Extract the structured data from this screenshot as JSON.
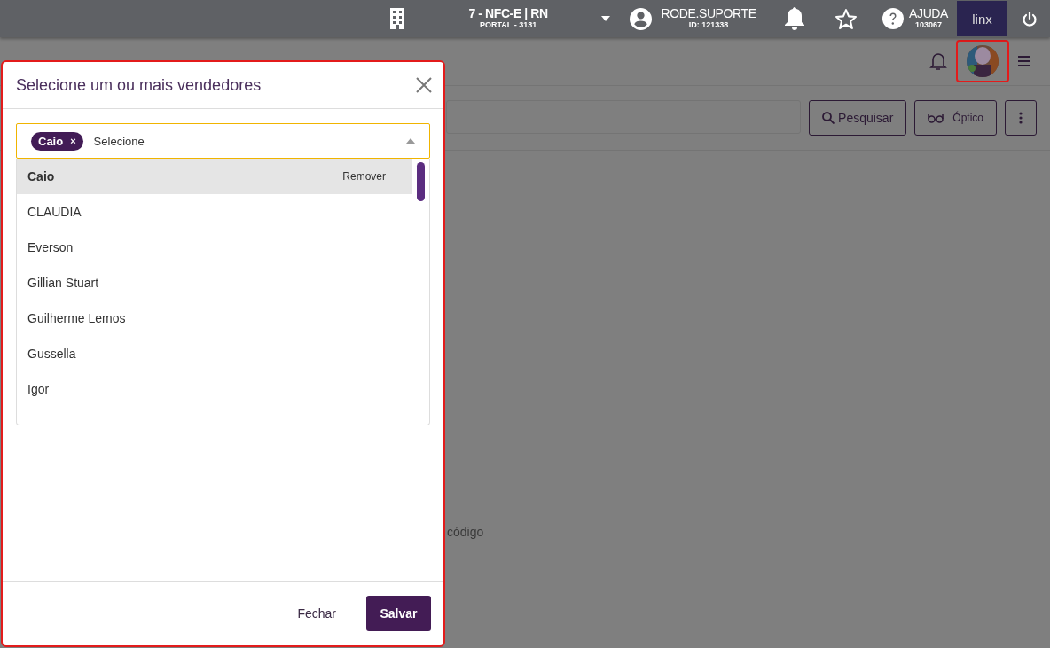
{
  "top_bar": {
    "store": {
      "title": "7 - NFC-E | RN",
      "subtitle": "PORTAL - 3131"
    },
    "user": {
      "name": "RODE.SUPORTE",
      "id": "ID: 121338"
    },
    "help": {
      "label": "AJUDA",
      "code": "103067"
    },
    "logo_text": "linx"
  },
  "page": {
    "search_button": "Pesquisar",
    "optical_button": "Óptico",
    "hint": "código"
  },
  "dialog": {
    "title": "Selecione um ou mais vendedores",
    "select": {
      "chips": [
        "Caio"
      ],
      "chip_remove": "×",
      "placeholder": "Selecione"
    },
    "options": [
      {
        "label": "Caio",
        "selected": true,
        "action": "Remover"
      },
      {
        "label": "CLAUDIA",
        "selected": false
      },
      {
        "label": "Everson",
        "selected": false
      },
      {
        "label": "Gillian Stuart",
        "selected": false
      },
      {
        "label": "Guilherme Lemos",
        "selected": false
      },
      {
        "label": "Gussella",
        "selected": false
      },
      {
        "label": "Igor",
        "selected": false
      }
    ],
    "buttons": {
      "close": "Fechar",
      "save": "Salvar"
    }
  }
}
